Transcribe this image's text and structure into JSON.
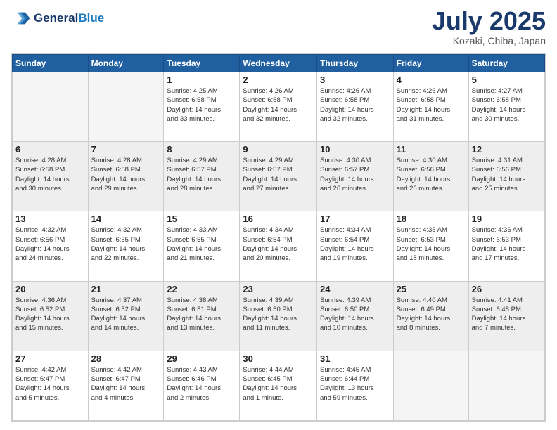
{
  "header": {
    "logo_line1": "General",
    "logo_line2": "Blue",
    "month": "July 2025",
    "location": "Kozaki, Chiba, Japan"
  },
  "days_of_week": [
    "Sunday",
    "Monday",
    "Tuesday",
    "Wednesday",
    "Thursday",
    "Friday",
    "Saturday"
  ],
  "weeks": [
    [
      {
        "day": "",
        "info": "",
        "empty": true
      },
      {
        "day": "",
        "info": "",
        "empty": true
      },
      {
        "day": "1",
        "info": "Sunrise: 4:25 AM\nSunset: 6:58 PM\nDaylight: 14 hours\nand 33 minutes."
      },
      {
        "day": "2",
        "info": "Sunrise: 4:26 AM\nSunset: 6:58 PM\nDaylight: 14 hours\nand 32 minutes."
      },
      {
        "day": "3",
        "info": "Sunrise: 4:26 AM\nSunset: 6:58 PM\nDaylight: 14 hours\nand 32 minutes."
      },
      {
        "day": "4",
        "info": "Sunrise: 4:26 AM\nSunset: 6:58 PM\nDaylight: 14 hours\nand 31 minutes."
      },
      {
        "day": "5",
        "info": "Sunrise: 4:27 AM\nSunset: 6:58 PM\nDaylight: 14 hours\nand 30 minutes."
      }
    ],
    [
      {
        "day": "6",
        "info": "Sunrise: 4:28 AM\nSunset: 6:58 PM\nDaylight: 14 hours\nand 30 minutes."
      },
      {
        "day": "7",
        "info": "Sunrise: 4:28 AM\nSunset: 6:58 PM\nDaylight: 14 hours\nand 29 minutes."
      },
      {
        "day": "8",
        "info": "Sunrise: 4:29 AM\nSunset: 6:57 PM\nDaylight: 14 hours\nand 28 minutes."
      },
      {
        "day": "9",
        "info": "Sunrise: 4:29 AM\nSunset: 6:57 PM\nDaylight: 14 hours\nand 27 minutes."
      },
      {
        "day": "10",
        "info": "Sunrise: 4:30 AM\nSunset: 6:57 PM\nDaylight: 14 hours\nand 26 minutes."
      },
      {
        "day": "11",
        "info": "Sunrise: 4:30 AM\nSunset: 6:56 PM\nDaylight: 14 hours\nand 26 minutes."
      },
      {
        "day": "12",
        "info": "Sunrise: 4:31 AM\nSunset: 6:56 PM\nDaylight: 14 hours\nand 25 minutes."
      }
    ],
    [
      {
        "day": "13",
        "info": "Sunrise: 4:32 AM\nSunset: 6:56 PM\nDaylight: 14 hours\nand 24 minutes."
      },
      {
        "day": "14",
        "info": "Sunrise: 4:32 AM\nSunset: 6:55 PM\nDaylight: 14 hours\nand 22 minutes."
      },
      {
        "day": "15",
        "info": "Sunrise: 4:33 AM\nSunset: 6:55 PM\nDaylight: 14 hours\nand 21 minutes."
      },
      {
        "day": "16",
        "info": "Sunrise: 4:34 AM\nSunset: 6:54 PM\nDaylight: 14 hours\nand 20 minutes."
      },
      {
        "day": "17",
        "info": "Sunrise: 4:34 AM\nSunset: 6:54 PM\nDaylight: 14 hours\nand 19 minutes."
      },
      {
        "day": "18",
        "info": "Sunrise: 4:35 AM\nSunset: 6:53 PM\nDaylight: 14 hours\nand 18 minutes."
      },
      {
        "day": "19",
        "info": "Sunrise: 4:36 AM\nSunset: 6:53 PM\nDaylight: 14 hours\nand 17 minutes."
      }
    ],
    [
      {
        "day": "20",
        "info": "Sunrise: 4:36 AM\nSunset: 6:52 PM\nDaylight: 14 hours\nand 15 minutes."
      },
      {
        "day": "21",
        "info": "Sunrise: 4:37 AM\nSunset: 6:52 PM\nDaylight: 14 hours\nand 14 minutes."
      },
      {
        "day": "22",
        "info": "Sunrise: 4:38 AM\nSunset: 6:51 PM\nDaylight: 14 hours\nand 13 minutes."
      },
      {
        "day": "23",
        "info": "Sunrise: 4:39 AM\nSunset: 6:50 PM\nDaylight: 14 hours\nand 11 minutes."
      },
      {
        "day": "24",
        "info": "Sunrise: 4:39 AM\nSunset: 6:50 PM\nDaylight: 14 hours\nand 10 minutes."
      },
      {
        "day": "25",
        "info": "Sunrise: 4:40 AM\nSunset: 6:49 PM\nDaylight: 14 hours\nand 8 minutes."
      },
      {
        "day": "26",
        "info": "Sunrise: 4:41 AM\nSunset: 6:48 PM\nDaylight: 14 hours\nand 7 minutes."
      }
    ],
    [
      {
        "day": "27",
        "info": "Sunrise: 4:42 AM\nSunset: 6:47 PM\nDaylight: 14 hours\nand 5 minutes."
      },
      {
        "day": "28",
        "info": "Sunrise: 4:42 AM\nSunset: 6:47 PM\nDaylight: 14 hours\nand 4 minutes."
      },
      {
        "day": "29",
        "info": "Sunrise: 4:43 AM\nSunset: 6:46 PM\nDaylight: 14 hours\nand 2 minutes."
      },
      {
        "day": "30",
        "info": "Sunrise: 4:44 AM\nSunset: 6:45 PM\nDaylight: 14 hours\nand 1 minute."
      },
      {
        "day": "31",
        "info": "Sunrise: 4:45 AM\nSunset: 6:44 PM\nDaylight: 13 hours\nand 59 minutes."
      },
      {
        "day": "",
        "info": "",
        "empty": true
      },
      {
        "day": "",
        "info": "",
        "empty": true
      }
    ]
  ]
}
